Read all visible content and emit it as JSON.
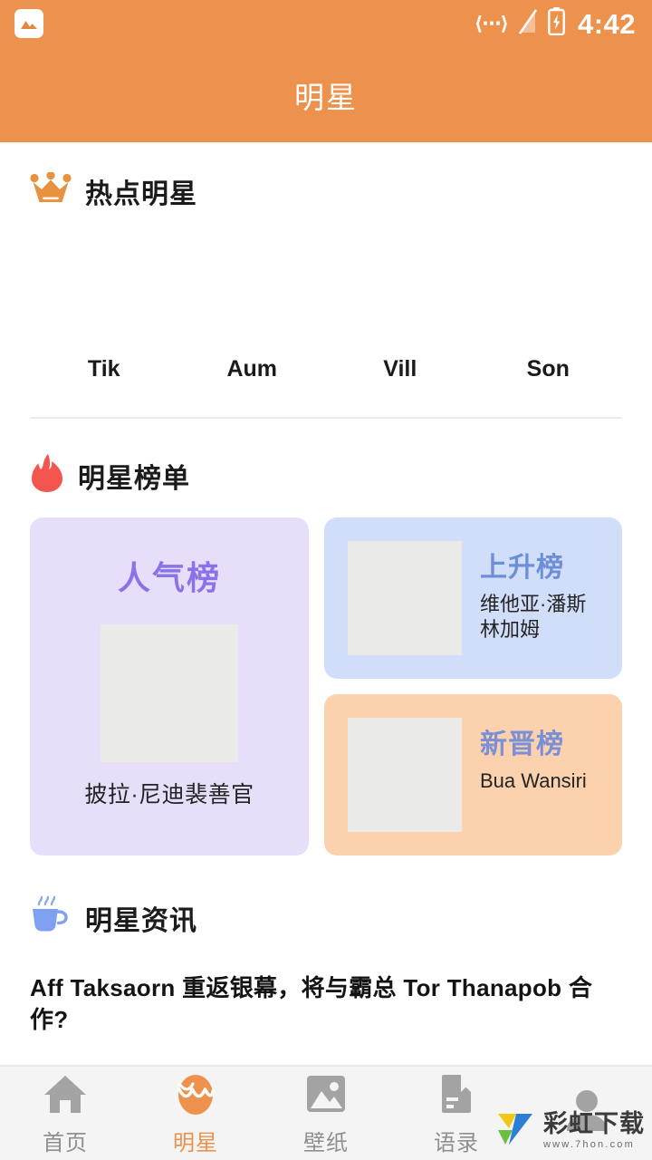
{
  "statusbar": {
    "notification_icon": "photo-icon",
    "dev_icon": "developer-mode-icon",
    "signal_icon": "signal-off-icon",
    "battery_icon": "battery-charging-icon",
    "time": "4:42"
  },
  "appbar": {
    "title": "明星"
  },
  "colors": {
    "brand_orange": "#ec924c",
    "card_lavender": "#e7dffa",
    "card_blue": "#d1defa",
    "card_peach": "#fcd2ae",
    "title_purple": "#8b72e8",
    "title_blue": "#6e8fd8",
    "title_periwinkle": "#7b8fd4",
    "placeholder_gray": "#eaeae8",
    "nav_inactive": "#8f8f8f"
  },
  "hot_stars": {
    "icon": "crown-icon",
    "title": "热点明星",
    "items": [
      {
        "name": "Tik"
      },
      {
        "name": "Aum"
      },
      {
        "name": "Vill"
      },
      {
        "name": "Son"
      }
    ]
  },
  "rankings": {
    "icon": "fire-icon",
    "title": "明星榜单",
    "popularity": {
      "title": "人气榜",
      "name": "披拉·尼迪裴善官"
    },
    "rising": {
      "title": "上升榜",
      "name": "维他亚·潘斯林加姆"
    },
    "newcomer": {
      "title": "新晋榜",
      "name": "Bua Wansiri"
    }
  },
  "news": {
    "icon": "coffee-icon",
    "title": "明星资讯",
    "items": [
      {
        "title": "Aff Taksaorn 重返银幕，将与霸总 Tor Thanapob 合作?"
      }
    ]
  },
  "bottomnav": {
    "items": [
      {
        "label": "首页",
        "icon": "home-icon",
        "active": false
      },
      {
        "label": "明星",
        "icon": "star-egg-icon",
        "active": true
      },
      {
        "label": "壁纸",
        "icon": "image-icon",
        "active": false
      },
      {
        "label": "语录",
        "icon": "book-icon",
        "active": false
      },
      {
        "label": "",
        "icon": "person-icon",
        "active": false
      }
    ]
  },
  "watermark": {
    "name": "彩虹下载",
    "url": "www.7hon.com"
  }
}
